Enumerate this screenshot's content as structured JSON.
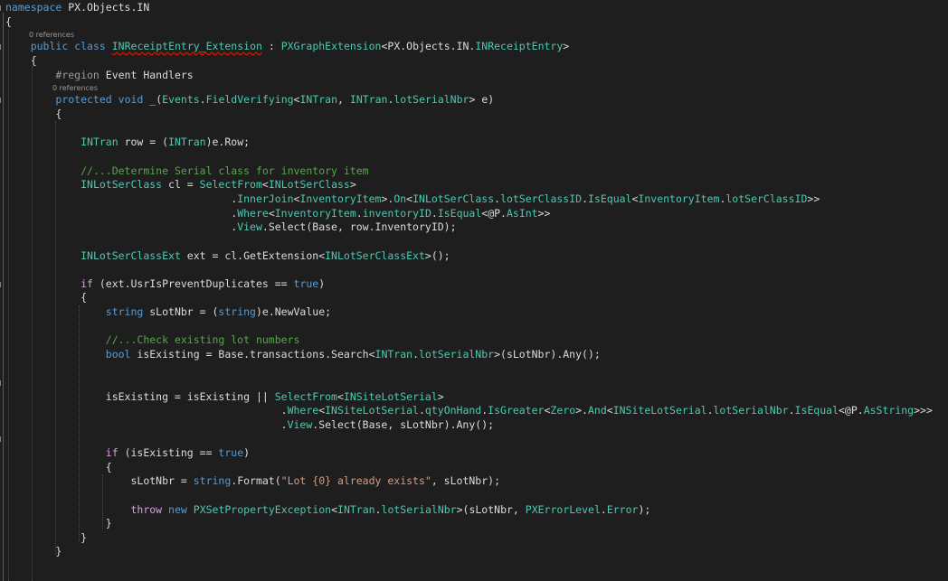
{
  "editor": {
    "code_lines": [
      [
        [
          "kw",
          "namespace"
        ],
        [
          "pl",
          " PX.Objects.IN"
        ]
      ],
      [
        [
          "pl",
          "{"
        ]
      ],
      [
        [
          "pl",
          "    "
        ],
        [
          "kw",
          "public"
        ],
        [
          "pl",
          " "
        ],
        [
          "kw",
          "class"
        ],
        [
          "pl",
          " "
        ],
        [
          "tye",
          "INReceiptEntry_Extension"
        ],
        [
          "pl",
          " : "
        ],
        [
          "ty",
          "PXGraphExtension"
        ],
        [
          "pl",
          "<PX.Objects.IN."
        ],
        [
          "ty",
          "INReceiptEntry"
        ],
        [
          "pl",
          ">"
        ]
      ],
      [
        [
          "pl",
          "    {"
        ]
      ],
      [
        [
          "pl",
          "        "
        ],
        [
          "rg",
          "#region"
        ],
        [
          "pl",
          " Event Handlers"
        ]
      ],
      [
        [
          "pl",
          "        "
        ],
        [
          "kw",
          "protected"
        ],
        [
          "pl",
          " "
        ],
        [
          "kw",
          "void"
        ],
        [
          "pl",
          " _("
        ],
        [
          "ty",
          "Events"
        ],
        [
          "pl",
          "."
        ],
        [
          "ty",
          "FieldVerifying"
        ],
        [
          "pl",
          "<"
        ],
        [
          "ty",
          "INTran"
        ],
        [
          "pl",
          ", "
        ],
        [
          "ty",
          "INTran"
        ],
        [
          "pl",
          "."
        ],
        [
          "ty",
          "lotSerialNbr"
        ],
        [
          "pl",
          "> e)"
        ]
      ],
      [
        [
          "pl",
          "        {"
        ]
      ],
      [
        [
          "pl",
          ""
        ]
      ],
      [
        [
          "pl",
          "            "
        ],
        [
          "ty",
          "INTran"
        ],
        [
          "pl",
          " row = ("
        ],
        [
          "ty",
          "INTran"
        ],
        [
          "pl",
          ")e.Row;"
        ]
      ],
      [
        [
          "pl",
          ""
        ]
      ],
      [
        [
          "pl",
          "            "
        ],
        [
          "cm",
          "//...Determine Serial class for inventory item"
        ]
      ],
      [
        [
          "pl",
          "            "
        ],
        [
          "ty",
          "INLotSerClass"
        ],
        [
          "pl",
          " cl = "
        ],
        [
          "ty",
          "SelectFrom"
        ],
        [
          "pl",
          "<"
        ],
        [
          "ty",
          "INLotSerClass"
        ],
        [
          "pl",
          ">"
        ]
      ],
      [
        [
          "pl",
          "                                    ."
        ],
        [
          "ty",
          "InnerJoin"
        ],
        [
          "pl",
          "<"
        ],
        [
          "ty",
          "InventoryItem"
        ],
        [
          "pl",
          ">."
        ],
        [
          "ty",
          "On"
        ],
        [
          "pl",
          "<"
        ],
        [
          "ty",
          "INLotSerClass"
        ],
        [
          "pl",
          "."
        ],
        [
          "ty",
          "lotSerClassID"
        ],
        [
          "pl",
          "."
        ],
        [
          "ty",
          "IsEqual"
        ],
        [
          "pl",
          "<"
        ],
        [
          "ty",
          "InventoryItem"
        ],
        [
          "pl",
          "."
        ],
        [
          "ty",
          "lotSerClassID"
        ],
        [
          "pl",
          ">>"
        ]
      ],
      [
        [
          "pl",
          "                                    ."
        ],
        [
          "ty",
          "Where"
        ],
        [
          "pl",
          "<"
        ],
        [
          "ty",
          "InventoryItem"
        ],
        [
          "pl",
          "."
        ],
        [
          "ty",
          "inventoryID"
        ],
        [
          "pl",
          "."
        ],
        [
          "ty",
          "IsEqual"
        ],
        [
          "pl",
          "<@P."
        ],
        [
          "ty",
          "AsInt"
        ],
        [
          "pl",
          ">>"
        ]
      ],
      [
        [
          "pl",
          "                                    ."
        ],
        [
          "ty",
          "View"
        ],
        [
          "pl",
          ".Select(Base, row.InventoryID);"
        ]
      ],
      [
        [
          "pl",
          ""
        ]
      ],
      [
        [
          "pl",
          "            "
        ],
        [
          "ty",
          "INLotSerClassExt"
        ],
        [
          "pl",
          " ext = cl.GetExtension<"
        ],
        [
          "ty",
          "INLotSerClassExt"
        ],
        [
          "pl",
          ">();"
        ]
      ],
      [
        [
          "pl",
          ""
        ]
      ],
      [
        [
          "pl",
          "            "
        ],
        [
          "kwc",
          "if"
        ],
        [
          "pl",
          " (ext.UsrIsPreventDuplicates == "
        ],
        [
          "kw",
          "true"
        ],
        [
          "pl",
          ")"
        ]
      ],
      [
        [
          "pl",
          "            {"
        ]
      ],
      [
        [
          "pl",
          "                "
        ],
        [
          "kw",
          "string"
        ],
        [
          "pl",
          " sLotNbr = ("
        ],
        [
          "kw",
          "string"
        ],
        [
          "pl",
          ")e.NewValue;"
        ]
      ],
      [
        [
          "pl",
          ""
        ]
      ],
      [
        [
          "pl",
          "                "
        ],
        [
          "cm",
          "//...Check existing lot numbers"
        ]
      ],
      [
        [
          "pl",
          "                "
        ],
        [
          "kw",
          "bool"
        ],
        [
          "pl",
          " isExisting = Base.transactions.Search<"
        ],
        [
          "ty",
          "INTran"
        ],
        [
          "pl",
          "."
        ],
        [
          "ty",
          "lotSerialNbr"
        ],
        [
          "pl",
          ">(sLotNbr).Any();"
        ]
      ],
      [
        [
          "pl",
          ""
        ]
      ],
      [
        [
          "pl",
          ""
        ]
      ],
      [
        [
          "pl",
          "                isExisting = isExisting || "
        ],
        [
          "ty",
          "SelectFrom"
        ],
        [
          "pl",
          "<"
        ],
        [
          "ty",
          "INSiteLotSerial"
        ],
        [
          "pl",
          ">"
        ]
      ],
      [
        [
          "pl",
          "                                            ."
        ],
        [
          "ty",
          "Where"
        ],
        [
          "pl",
          "<"
        ],
        [
          "ty",
          "INSiteLotSerial"
        ],
        [
          "pl",
          "."
        ],
        [
          "ty",
          "qtyOnHand"
        ],
        [
          "pl",
          "."
        ],
        [
          "ty",
          "IsGreater"
        ],
        [
          "pl",
          "<"
        ],
        [
          "ty",
          "Zero"
        ],
        [
          "pl",
          ">."
        ],
        [
          "ty",
          "And"
        ],
        [
          "pl",
          "<"
        ],
        [
          "ty",
          "INSiteLotSerial"
        ],
        [
          "pl",
          "."
        ],
        [
          "ty",
          "lotSerialNbr"
        ],
        [
          "pl",
          "."
        ],
        [
          "ty",
          "IsEqual"
        ],
        [
          "pl",
          "<@P."
        ],
        [
          "ty",
          "AsString"
        ],
        [
          "pl",
          ">>>"
        ]
      ],
      [
        [
          "pl",
          "                                            ."
        ],
        [
          "ty",
          "View"
        ],
        [
          "pl",
          ".Select(Base, sLotNbr).Any();"
        ]
      ],
      [
        [
          "pl",
          ""
        ]
      ],
      [
        [
          "pl",
          "                "
        ],
        [
          "kwc",
          "if"
        ],
        [
          "pl",
          " (isExisting == "
        ],
        [
          "kw",
          "true"
        ],
        [
          "pl",
          ")"
        ]
      ],
      [
        [
          "pl",
          "                {"
        ]
      ],
      [
        [
          "pl",
          "                    sLotNbr = "
        ],
        [
          "kw",
          "string"
        ],
        [
          "pl",
          ".Format("
        ],
        [
          "st",
          "\"Lot {0} already exists\""
        ],
        [
          "pl",
          ", sLotNbr);"
        ]
      ],
      [
        [
          "pl",
          ""
        ]
      ],
      [
        [
          "pl",
          "                    "
        ],
        [
          "kwc",
          "throw"
        ],
        [
          "pl",
          " "
        ],
        [
          "kw",
          "new"
        ],
        [
          "pl",
          " "
        ],
        [
          "ty",
          "PXSetPropertyException"
        ],
        [
          "pl",
          "<"
        ],
        [
          "ty",
          "INTran"
        ],
        [
          "pl",
          "."
        ],
        [
          "ty",
          "lotSerialNbr"
        ],
        [
          "pl",
          ">(sLotNbr, "
        ],
        [
          "ty",
          "PXErrorLevel"
        ],
        [
          "pl",
          "."
        ],
        [
          "ty",
          "Error"
        ],
        [
          "pl",
          ");"
        ]
      ],
      [
        [
          "pl",
          "                }"
        ]
      ],
      [
        [
          "pl",
          "            }"
        ]
      ],
      [
        [
          "pl",
          "        }"
        ]
      ]
    ],
    "codelens": [
      {
        "text": "0 references"
      },
      {
        "text": "0 references"
      }
    ]
  }
}
